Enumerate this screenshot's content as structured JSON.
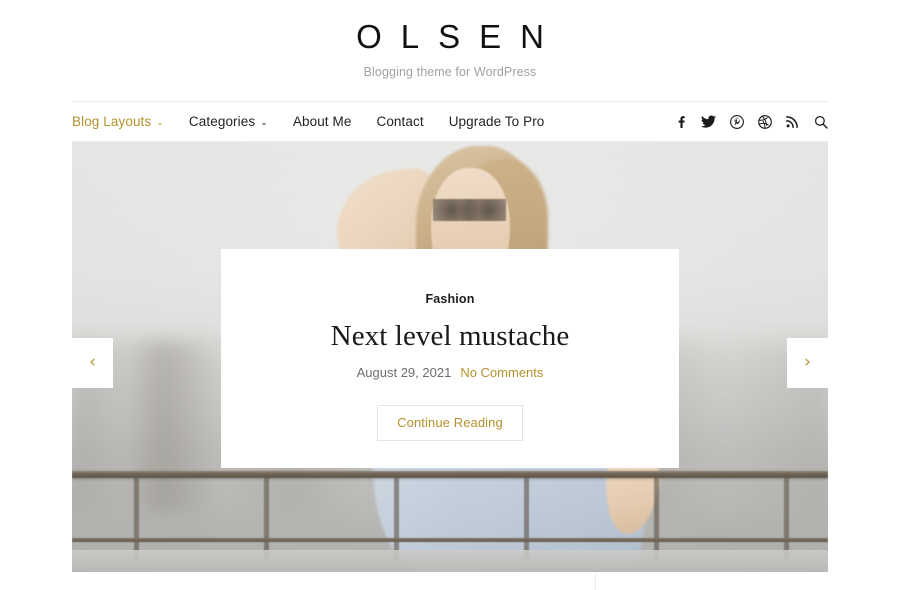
{
  "site": {
    "title": "OLSEN",
    "tagline": "Blogging theme for WordPress"
  },
  "nav": {
    "items": [
      {
        "label": "Blog Layouts",
        "has_caret": true,
        "active": true,
        "caret": "⌄"
      },
      {
        "label": "Categories",
        "has_caret": true,
        "active": false,
        "caret": "⌄"
      },
      {
        "label": "About Me",
        "has_caret": false,
        "active": false,
        "caret": ""
      },
      {
        "label": "Contact",
        "has_caret": false,
        "active": false,
        "caret": ""
      },
      {
        "label": "Upgrade To Pro",
        "has_caret": false,
        "active": false,
        "caret": ""
      }
    ],
    "social": [
      {
        "name": "facebook-icon",
        "title": "Facebook"
      },
      {
        "name": "twitter-icon",
        "title": "Twitter"
      },
      {
        "name": "pinterest-icon",
        "title": "Pinterest"
      },
      {
        "name": "dribbble-icon",
        "title": "Dribbble"
      },
      {
        "name": "rss-icon",
        "title": "RSS"
      },
      {
        "name": "search-icon",
        "title": "Search"
      }
    ]
  },
  "slider": {
    "prev_glyph": "‹",
    "next_glyph": "›",
    "slide": {
      "category": "Fashion",
      "title": "Next level mustache",
      "date": "August 29, 2021",
      "comments": "No Comments",
      "cta": "Continue Reading"
    }
  },
  "colors": {
    "accent_gold": "#b3912f",
    "text_dark": "#1a1a1a",
    "text_muted": "#6d6d6d",
    "tagline_gray": "#a2a2a2",
    "border_light": "#ececec",
    "button_border": "#e3e3e3",
    "page_bg": "#ffffff"
  }
}
